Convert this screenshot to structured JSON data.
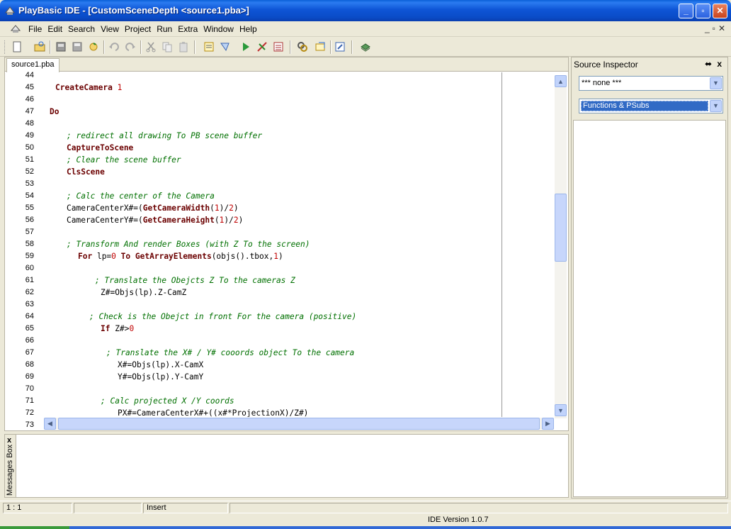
{
  "window": {
    "title": "PlayBasic IDE - [CustomSceneDepth <source1.pba>]",
    "min_label": "_",
    "max_label": "▫",
    "close_label": "✕"
  },
  "menu": {
    "items": [
      "File",
      "Edit",
      "Search",
      "View",
      "Project",
      "Run",
      "Extra",
      "Window",
      "Help"
    ],
    "mdi_min": "_",
    "mdi_restore": "▫",
    "mdi_close": "✕"
  },
  "toolbar": {
    "buttons": [
      "new-file",
      "open-file",
      "save-all",
      "save",
      "reload",
      "undo",
      "redo",
      "cut",
      "copy",
      "paste",
      "compile",
      "build",
      "run",
      "stop",
      "debug",
      "find",
      "find-replace",
      "edit",
      "help-book"
    ]
  },
  "editor": {
    "tab_label": "source1.pba",
    "lines": [
      {
        "n": "44",
        "parts": []
      },
      {
        "n": "45",
        "indent": 1,
        "parts": [
          {
            "c": "kw",
            "t": "CreateCamera"
          },
          {
            "c": "",
            "t": " "
          },
          {
            "c": "num",
            "t": "1"
          }
        ]
      },
      {
        "n": "46",
        "parts": []
      },
      {
        "n": "47",
        "indent": 0,
        "parts": [
          {
            "c": "kw",
            "t": "Do"
          }
        ]
      },
      {
        "n": "48",
        "parts": []
      },
      {
        "n": "49",
        "indent": 3,
        "parts": [
          {
            "c": "cm",
            "t": "; redirect all drawing To PB scene buffer"
          }
        ]
      },
      {
        "n": "50",
        "indent": 3,
        "parts": [
          {
            "c": "kw",
            "t": "CaptureToScene"
          }
        ]
      },
      {
        "n": "51",
        "indent": 3,
        "parts": [
          {
            "c": "cm",
            "t": "; Clear the scene buffer"
          }
        ]
      },
      {
        "n": "52",
        "indent": 3,
        "parts": [
          {
            "c": "kw",
            "t": "ClsScene"
          }
        ]
      },
      {
        "n": "53",
        "parts": []
      },
      {
        "n": "54",
        "indent": 3,
        "parts": [
          {
            "c": "cm",
            "t": "; Calc the center of the Camera"
          }
        ]
      },
      {
        "n": "55",
        "indent": 3,
        "parts": [
          {
            "c": "",
            "t": "CameraCenterX#=("
          },
          {
            "c": "kw",
            "t": "GetCameraWidth"
          },
          {
            "c": "",
            "t": "("
          },
          {
            "c": "num",
            "t": "1"
          },
          {
            "c": "",
            "t": ")/"
          },
          {
            "c": "num",
            "t": "2"
          },
          {
            "c": "",
            "t": ")"
          }
        ]
      },
      {
        "n": "56",
        "indent": 3,
        "parts": [
          {
            "c": "",
            "t": "CameraCenterY#=("
          },
          {
            "c": "kw",
            "t": "GetCameraHeight"
          },
          {
            "c": "",
            "t": "("
          },
          {
            "c": "num",
            "t": "1"
          },
          {
            "c": "",
            "t": ")/"
          },
          {
            "c": "num",
            "t": "2"
          },
          {
            "c": "",
            "t": ")"
          }
        ]
      },
      {
        "n": "57",
        "parts": []
      },
      {
        "n": "58",
        "indent": 3,
        "parts": [
          {
            "c": "cm",
            "t": "; Transform And render Boxes (with Z To the screen)"
          }
        ]
      },
      {
        "n": "59",
        "indent": 5,
        "parts": [
          {
            "c": "kw",
            "t": "For"
          },
          {
            "c": "",
            "t": " lp="
          },
          {
            "c": "num",
            "t": "0"
          },
          {
            "c": "",
            "t": " "
          },
          {
            "c": "kw",
            "t": "To"
          },
          {
            "c": "",
            "t": " "
          },
          {
            "c": "kw",
            "t": "GetArrayElements"
          },
          {
            "c": "",
            "t": "(objs().tbox,"
          },
          {
            "c": "num",
            "t": "1"
          },
          {
            "c": "",
            "t": ")"
          }
        ]
      },
      {
        "n": "60",
        "parts": []
      },
      {
        "n": "61",
        "indent": 8,
        "parts": [
          {
            "c": "cm",
            "t": "; Translate the Obejcts Z To the cameras Z"
          }
        ]
      },
      {
        "n": "62",
        "indent": 9,
        "parts": [
          {
            "c": "",
            "t": "Z#=Objs(lp).Z-CamZ"
          }
        ]
      },
      {
        "n": "63",
        "parts": []
      },
      {
        "n": "64",
        "indent": 7,
        "parts": [
          {
            "c": "cm",
            "t": "; Check is the Obejct in front For the camera (positive)"
          }
        ]
      },
      {
        "n": "65",
        "indent": 9,
        "parts": [
          {
            "c": "kw",
            "t": "If"
          },
          {
            "c": "",
            "t": " Z#>"
          },
          {
            "c": "num",
            "t": "0"
          }
        ]
      },
      {
        "n": "66",
        "parts": []
      },
      {
        "n": "67",
        "indent": 10,
        "parts": [
          {
            "c": "cm",
            "t": "; Translate the X# / Y# cooords object To the camera"
          }
        ]
      },
      {
        "n": "68",
        "indent": 12,
        "parts": [
          {
            "c": "",
            "t": "X#=Objs(lp).X-CamX"
          }
        ]
      },
      {
        "n": "69",
        "indent": 12,
        "parts": [
          {
            "c": "",
            "t": "Y#=Objs(lp).Y-CamY"
          }
        ]
      },
      {
        "n": "70",
        "parts": []
      },
      {
        "n": "71",
        "indent": 9,
        "parts": [
          {
            "c": "cm",
            "t": "; Calc projected X /Y coords"
          }
        ]
      },
      {
        "n": "72",
        "indent": 12,
        "parts": [
          {
            "c": "",
            "t": "PX#=CameraCenterX#+((x#*ProjectionX)/Z#)"
          }
        ]
      },
      {
        "n": "73",
        "parts": []
      }
    ]
  },
  "messages": {
    "label": "Messages Box",
    "close_label": "x"
  },
  "inspector": {
    "title": "Source Inspector",
    "pin_label": "⬌",
    "close_label": "x",
    "combo1": "*** none ***",
    "combo2": "Functions & PSubs"
  },
  "status": {
    "position": "1 :  1",
    "mode": "Insert",
    "version": "IDE Version 1.0.7"
  },
  "colors": {
    "keyword": "#6b0000",
    "number": "#c00000",
    "comment": "#007000",
    "titlebar": "#0a4cc8"
  }
}
